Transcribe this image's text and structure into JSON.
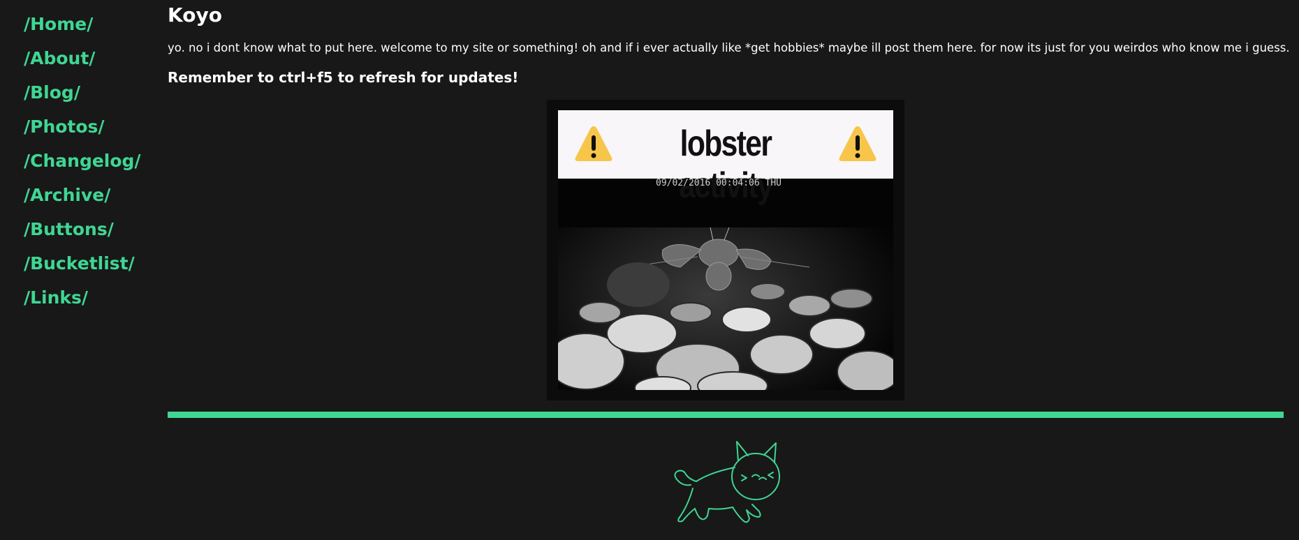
{
  "nav": {
    "items": [
      {
        "label": "/Home/"
      },
      {
        "label": "/About/"
      },
      {
        "label": "/Blog/"
      },
      {
        "label": "/Photos/"
      },
      {
        "label": "/Changelog/"
      },
      {
        "label": "/Archive/"
      },
      {
        "label": "/Buttons/"
      },
      {
        "label": "/Bucketlist/"
      },
      {
        "label": "/Links/"
      }
    ]
  },
  "main": {
    "title": "Koyo",
    "intro": "yo. no i dont know what to put here. welcome to my site or something! oh and if i ever actually like *get hobbies* maybe ill post them here. for now its just for you weirdos who know me i guess.",
    "reminder": "Remember to ctrl+f5 to refresh for updates!",
    "gif": {
      "banner_text": "lobster activity",
      "cam_timestamp": "09/02/2016 00:04:06 THU",
      "icons": [
        "warning-icon",
        "warning-icon"
      ]
    },
    "footer_icon": "cat-icon"
  },
  "colors": {
    "background": "#181818",
    "accent": "#3fd694",
    "text": "#ffffff",
    "warning": "#f7c54a"
  }
}
